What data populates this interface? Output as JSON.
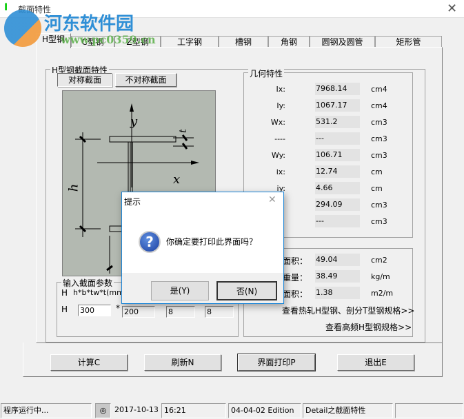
{
  "window": {
    "title": "截面特性",
    "close_icon": "close-icon"
  },
  "watermark": {
    "name": "河东软件园",
    "url": "www.pc0359.cn"
  },
  "tabs": [
    {
      "label": "H型钢",
      "active": true
    },
    {
      "label": "C型钢"
    },
    {
      "label": "Z型钢"
    },
    {
      "label": "工字钢"
    },
    {
      "label": "槽钢"
    },
    {
      "label": "角钢"
    },
    {
      "label": "圆钢及圆管"
    },
    {
      "label": "矩形管"
    }
  ],
  "section_group": {
    "title": "H型钢截面特性",
    "sym_button": "对称截面",
    "asym_button": "不对称截面"
  },
  "diagram": {
    "y_label": "y",
    "x_label": "x",
    "h_label": "h",
    "t_label": "t"
  },
  "input_group": {
    "title": "输入截面参数",
    "row_label": "H",
    "format": "h*b*tw*t(mm)",
    "row2_label": "H",
    "values": [
      "300",
      "200",
      "8",
      "8"
    ],
    "sep": "*"
  },
  "geometry": {
    "title": "几何特性",
    "rows": [
      {
        "label": "Ix:",
        "value": "7968.14",
        "unit": "cm4"
      },
      {
        "label": "Iy:",
        "value": "1067.17",
        "unit": "cm4"
      },
      {
        "label": "Wx:",
        "value": "531.2",
        "unit": "cm3"
      },
      {
        "label": "----",
        "value": "---",
        "unit": "cm3"
      },
      {
        "label": "Wy:",
        "value": "106.71",
        "unit": "cm3"
      },
      {
        "label": "ix:",
        "value": "12.74",
        "unit": "cm"
      },
      {
        "label": "iy:",
        "value": "4.66",
        "unit": "cm"
      },
      {
        "label": "",
        "value": "294.09",
        "unit": "cm3"
      },
      {
        "label": "",
        "value": "---",
        "unit": "cm3"
      }
    ]
  },
  "properties": {
    "rows": [
      {
        "label": "面积：",
        "value": "49.04",
        "unit": "cm2"
      },
      {
        "label": "重量：",
        "value": "38.49",
        "unit": "kg/m"
      },
      {
        "label": "面积：",
        "value": "1.38",
        "unit": "m2/m"
      }
    ],
    "link1": "查看热轧H型钢、剖分T型钢规格>>",
    "link2": "查看高频H型钢规格>>"
  },
  "buttons": {
    "calc": "计算C",
    "refresh": "刷新N",
    "print": "界面打印P",
    "exit": "退出E"
  },
  "dialog": {
    "title": "提示",
    "message": "你确定要打印此界面吗？",
    "yes": "是(Y)",
    "no": "否(N)",
    "icon": "question-icon"
  },
  "statusbar": {
    "status": "程序运行中...",
    "date": "2017-10-13",
    "time": "16:21",
    "edition": "04-04-02 Edition",
    "module": "Detail之截面特性",
    "extra": ""
  }
}
